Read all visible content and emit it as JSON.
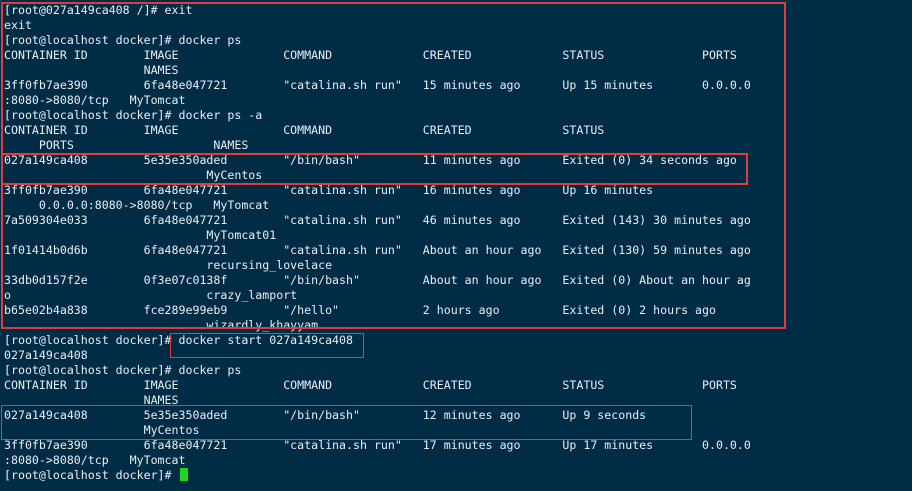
{
  "terminal": {
    "lines": [
      "[root@027a149ca408 /]# exit",
      "exit",
      "[root@localhost docker]# docker ps",
      "CONTAINER ID        IMAGE               COMMAND             CREATED             STATUS              PORTS",
      "                    NAMES",
      "3ff0fb7ae390        6fa48e047721        \"catalina.sh run\"   15 minutes ago      Up 15 minutes       0.0.0.0",
      ":8080->8080/tcp   MyTomcat",
      "[root@localhost docker]# docker ps -a",
      "CONTAINER ID        IMAGE               COMMAND             CREATED             STATUS",
      "     PORTS                    NAMES",
      "027a149ca408        5e35e350aded        \"/bin/bash\"         11 minutes ago      Exited (0) 34 seconds ago",
      "                             MyCentos",
      "3ff0fb7ae390        6fa48e047721        \"catalina.sh run\"   16 minutes ago      Up 16 minutes",
      "     0.0.0.0:8080->8080/tcp   MyTomcat",
      "7a509304e033        6fa48e047721        \"catalina.sh run\"   46 minutes ago      Exited (143) 30 minutes ago",
      "                             MyTomcat01",
      "1f01414b0d6b        6fa48e047721        \"catalina.sh run\"   About an hour ago   Exited (130) 59 minutes ago",
      "                             recursing_lovelace",
      "33db0d157f2e        0f3e07c0138f        \"/bin/bash\"         About an hour ago   Exited (0) About an hour ag",
      "o                            crazy_lamport",
      "b65e02b4a838        fce289e99eb9        \"/hello\"            2 hours ago         Exited (0) 2 hours ago",
      "                             wizardly_khayyam",
      "[root@localhost docker]# docker start 027a149ca408",
      "027a149ca408",
      "[root@localhost docker]# docker ps",
      "CONTAINER ID        IMAGE               COMMAND             CREATED             STATUS              PORTS",
      "                    NAMES",
      "027a149ca408        5e35e350aded        \"/bin/bash\"         12 minutes ago      Up 9 seconds",
      "                    MyCentos",
      "3ff0fb7ae390        6fa48e047721        \"catalina.sh run\"   17 minutes ago      Up 17 minutes       0.0.0.0",
      ":8080->8080/tcp   MyTomcat"
    ],
    "prompt": "[root@localhost docker]# ",
    "colors": {
      "background": "#012c45",
      "text": "#e8eef2",
      "annotation": "#e23b3b",
      "cursor": "#22d322"
    }
  }
}
